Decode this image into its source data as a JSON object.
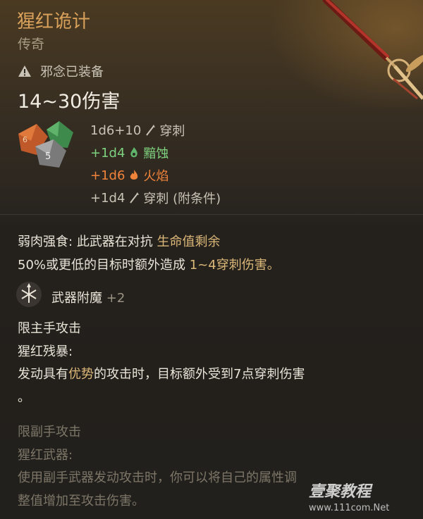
{
  "item": {
    "name": "猩红诡计",
    "rarity": "传奇",
    "status": "邪念已装备",
    "damage": "14~30伤害"
  },
  "damage_rows": [
    {
      "dice": "1d6+10",
      "type": "穿刺",
      "color": "#c9c3b6",
      "icon": "piercing-icon"
    },
    {
      "dice": "+1d4",
      "type": "黯蚀",
      "color": "#7ed17e",
      "icon": "necrotic-icon"
    },
    {
      "dice": "+1d6",
      "type": "火焰",
      "color": "#f0833a",
      "icon": "fire-icon"
    },
    {
      "dice": "+1d4",
      "type": "穿刺 (附条件)",
      "color": "#c9c3b6",
      "icon": "piercing-icon"
    }
  ],
  "passive": {
    "name": "弱肉强食:",
    "line1_pre": "此武器在对抗",
    "line1_hl": "生命值剩余",
    "line2_pre": "50%或更低的目标时额外造成",
    "line2_hl": "1~4穿刺伤害。"
  },
  "enchant": {
    "label": "武器附魔",
    "bonus": "+2"
  },
  "main_hand": {
    "restriction": "限主手攻击",
    "name": "猩红残暴:",
    "desc_pre": "发动具有",
    "desc_hl": "优势",
    "desc_post": "的攻击时，目标额外受到7点穿刺伤害",
    "desc_end": "。"
  },
  "off_hand": {
    "restriction": "限副手攻击",
    "name": "猩红武器:",
    "desc_line1": "使用副手武器发动攻击时，你可以将自己的属性调",
    "desc_line2": "整值增加至攻击伤害。"
  },
  "watermark": {
    "brand": "壹聚教程",
    "url": "www.111com.Net"
  },
  "colors": {
    "title": "#d9a15a",
    "highlight": "#dcb878",
    "necrotic": "#7ed17e",
    "fire": "#f0833a",
    "muted": "#7d7668"
  }
}
